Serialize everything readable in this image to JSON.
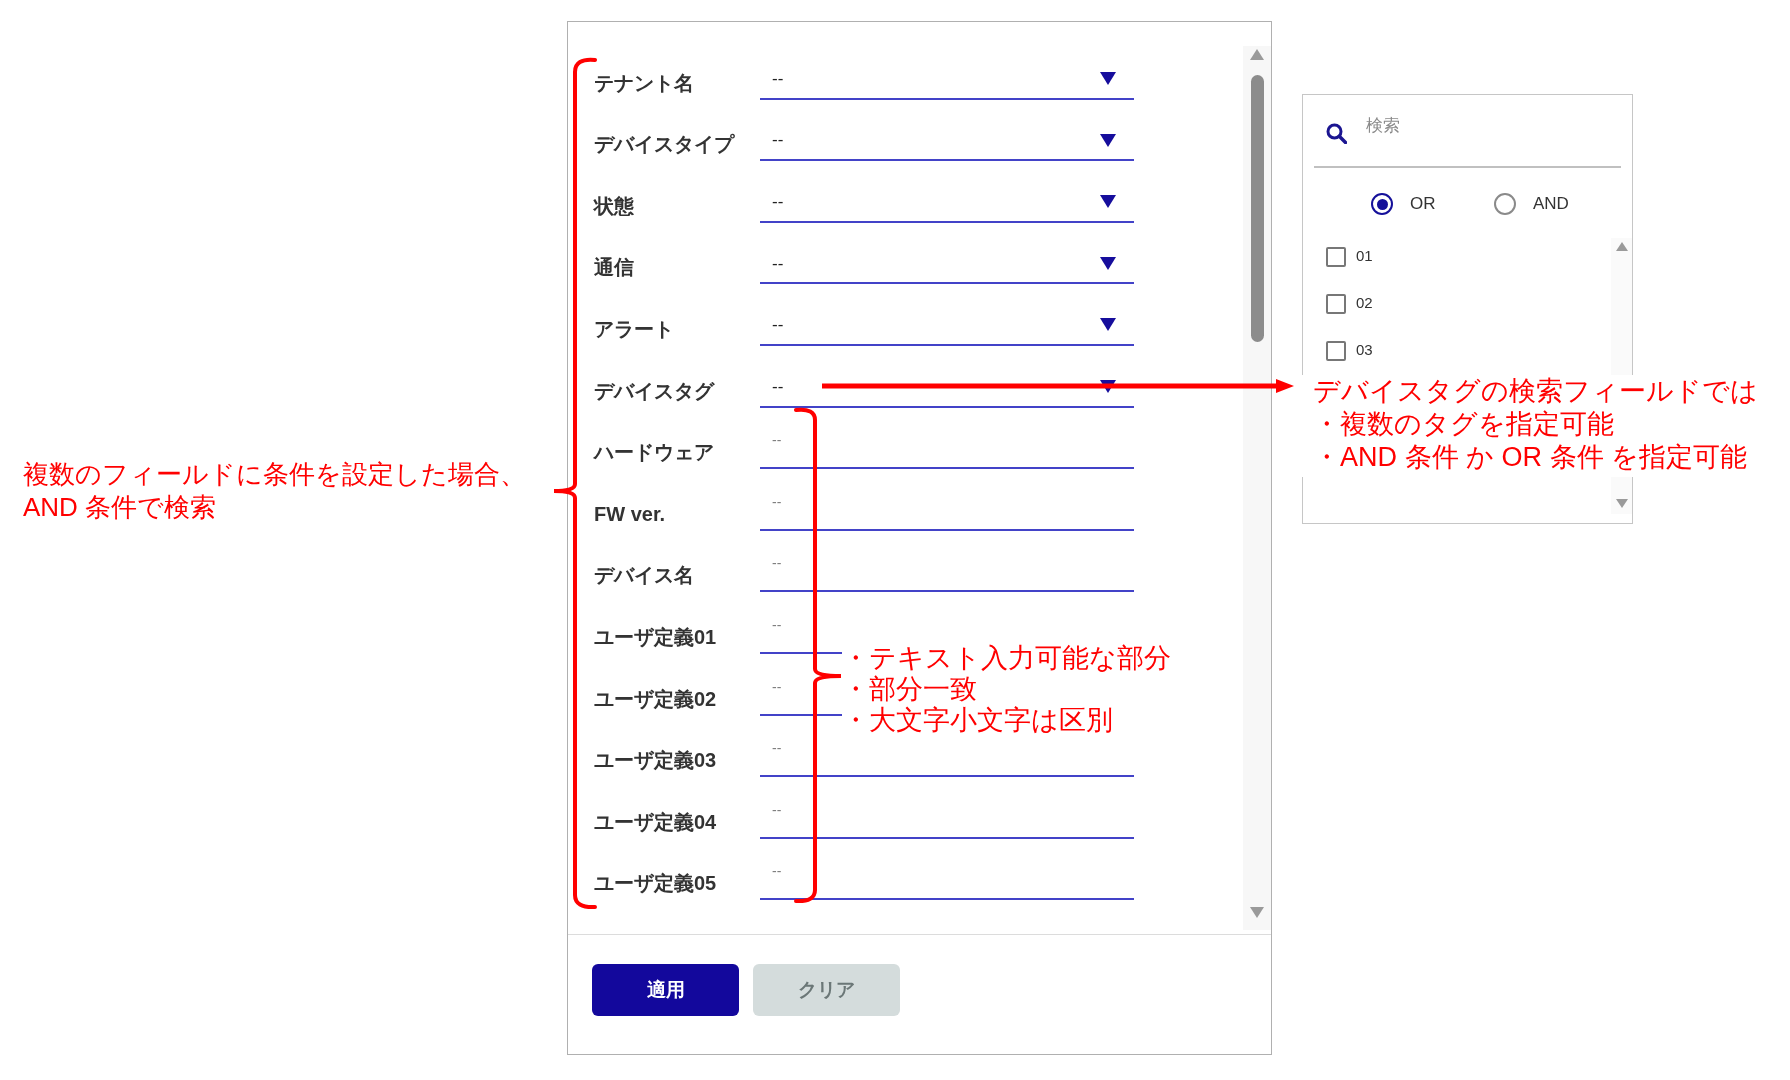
{
  "filter_panel": {
    "fields": [
      {
        "label": "テナント名",
        "kind": "dropdown",
        "value": "--"
      },
      {
        "label": "デバイスタイプ",
        "kind": "dropdown",
        "value": "--"
      },
      {
        "label": "状態",
        "kind": "dropdown",
        "value": "--"
      },
      {
        "label": "通信",
        "kind": "dropdown",
        "value": "--"
      },
      {
        "label": "アラート",
        "kind": "dropdown",
        "value": "--"
      },
      {
        "label": "デバイスタグ",
        "kind": "dropdown",
        "value": "--"
      },
      {
        "label": "ハードウェア",
        "kind": "text",
        "placeholder": "--"
      },
      {
        "label": "FW ver.",
        "kind": "text",
        "placeholder": "--"
      },
      {
        "label": "デバイス名",
        "kind": "text",
        "placeholder": "--"
      },
      {
        "label": "ユーザ定義01",
        "kind": "text",
        "placeholder": "--"
      },
      {
        "label": "ユーザ定義02",
        "kind": "text",
        "placeholder": "--"
      },
      {
        "label": "ユーザ定義03",
        "kind": "text",
        "placeholder": "--"
      },
      {
        "label": "ユーザ定義04",
        "kind": "text",
        "placeholder": "--"
      },
      {
        "label": "ユーザ定義05",
        "kind": "text",
        "placeholder": "--"
      }
    ],
    "buttons": [
      {
        "label": "適用",
        "disabled": false
      },
      {
        "label": "クリア",
        "disabled": true
      }
    ]
  },
  "annotations": [
    {
      "kind": "note",
      "lines": [
        "複数のフィールドに条件を設定した場合、",
        "AND 条件で検索"
      ]
    },
    {
      "kind": "bullets",
      "items": [
        "・テキスト入力可能な部分",
        "・部分一致",
        "・大文字小文字は区別"
      ]
    },
    {
      "kind": "bullets",
      "heading": "デバイスタグの検索フィールドでは",
      "items": [
        "・複数のタグを指定可能",
        "・AND 条件 か OR 条件 を指定可能"
      ]
    }
  ],
  "tag_dropdown": {
    "search": {
      "placeholder": "検索"
    },
    "match_modes": [
      {
        "label": "OR",
        "selected": true
      },
      {
        "label": "AND",
        "selected": false
      }
    ],
    "tags": [
      {
        "label": "01",
        "checked": false
      },
      {
        "label": "02",
        "checked": false
      },
      {
        "label": "03",
        "checked": false
      }
    ]
  }
}
